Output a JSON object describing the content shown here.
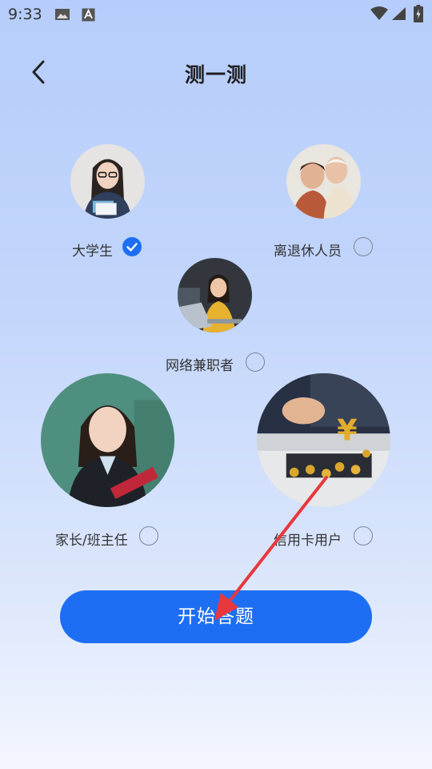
{
  "status_bar": {
    "time": "9:33",
    "icons": [
      "image-icon",
      "font-a-icon",
      "wifi-icon",
      "signal-icon",
      "battery-charging-icon"
    ]
  },
  "header": {
    "back_icon": "chevron-left-icon",
    "title": "测一测"
  },
  "options": [
    {
      "label": "大学生",
      "selected": true
    },
    {
      "label": "离退休人员",
      "selected": false
    },
    {
      "label": "网络兼职者",
      "selected": false
    },
    {
      "label": "家长/班主任",
      "selected": false
    },
    {
      "label": "信用卡用户",
      "selected": false
    }
  ],
  "start_button": {
    "label": "开始答题"
  },
  "colors": {
    "accent": "#1e6ef4",
    "annotation_arrow": "#e8383d"
  }
}
